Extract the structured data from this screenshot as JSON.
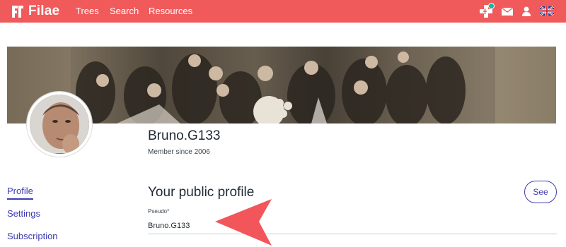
{
  "header": {
    "logo_text": "Filae",
    "nav": [
      "Trees",
      "Search",
      "Resources"
    ],
    "icons": [
      "add-tree-icon",
      "mail-icon",
      "user-icon",
      "uk-flag-icon"
    ],
    "brand_color": "#f05a5b",
    "notification_color": "#12b8a0"
  },
  "profile": {
    "username": "Bruno.G133",
    "member_since": "Member since 2006"
  },
  "sidebar": {
    "items": [
      {
        "label": "Profile",
        "active": true
      },
      {
        "label": "Settings",
        "active": false
      },
      {
        "label": "Subscription",
        "active": false
      }
    ]
  },
  "main": {
    "section_title": "Your public profile",
    "see_button": "See",
    "pseudo_label": "Pseudo*",
    "pseudo_value": "Bruno.G133"
  },
  "annotation": {
    "arrow_color": "#f2565a"
  }
}
